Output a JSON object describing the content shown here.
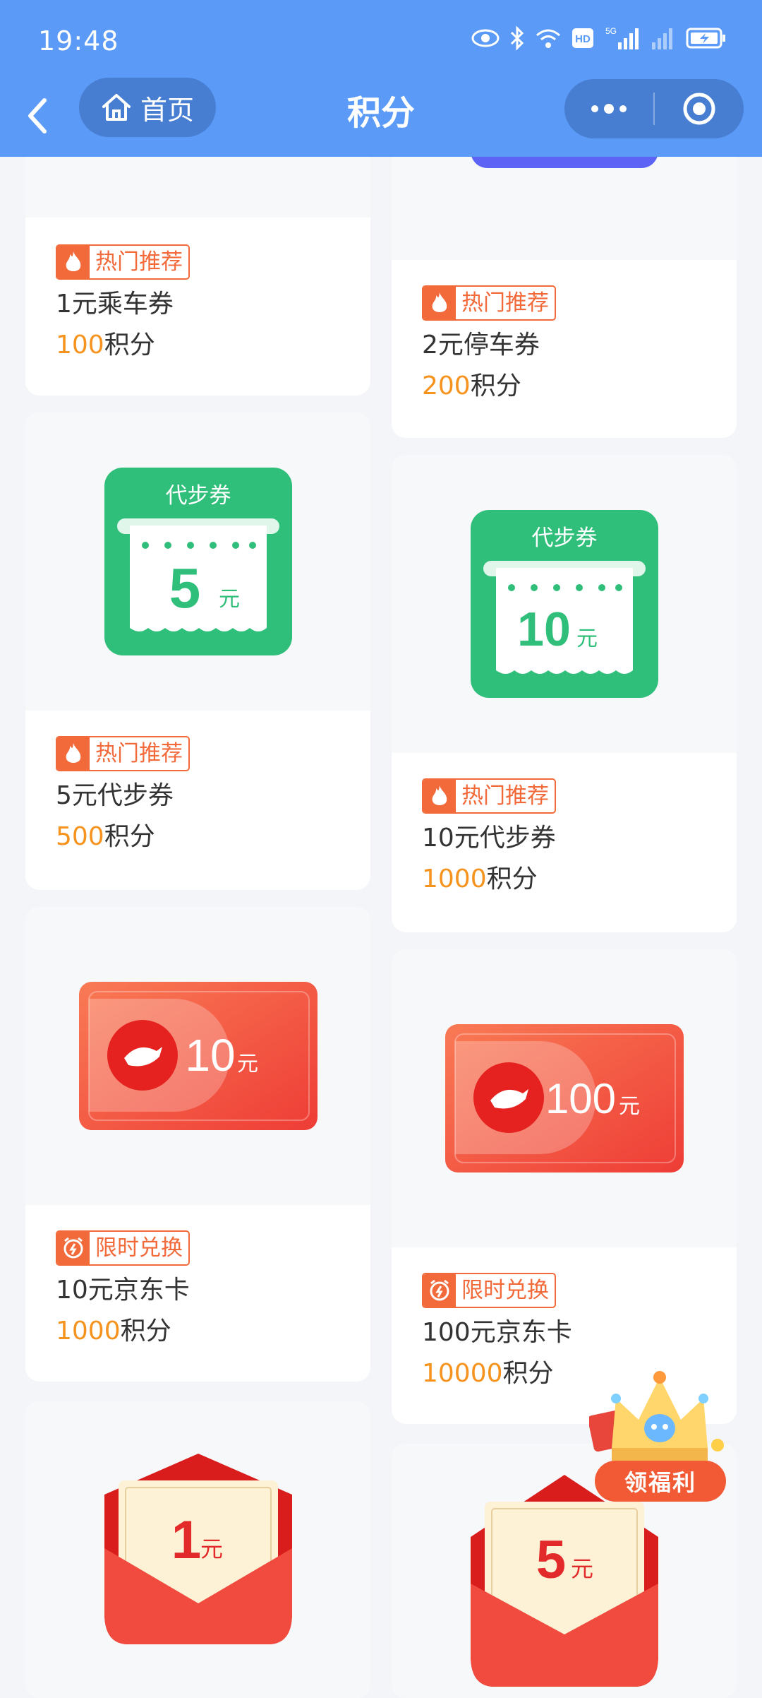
{
  "status_bar": {
    "time": "19:48",
    "net_label": "5G"
  },
  "nav": {
    "home_label": "首页",
    "title": "积分"
  },
  "tag_labels": {
    "hot": "热门推荐",
    "limited": "限时兑换"
  },
  "points_unit": "积分",
  "currency_unit": "元",
  "voucher_banner": "代步券",
  "left_column": [
    {
      "name": "1元乘车券",
      "points": "100",
      "tag": "热门推荐"
    },
    {
      "name": "5元代步券",
      "points": "500",
      "tag": "热门推荐",
      "amount": "5"
    },
    {
      "name": "10元京东卡",
      "points": "1000",
      "tag": "限时兑换",
      "amount": "10"
    },
    {
      "amount": "1"
    }
  ],
  "right_column": [
    {
      "name": "2元停车券",
      "points": "200",
      "tag": "热门推荐"
    },
    {
      "name": "10元代步券",
      "points": "1000",
      "tag": "热门推荐",
      "amount": "10"
    },
    {
      "name": "100元京东卡",
      "points": "10000",
      "tag": "限时兑换",
      "amount": "100"
    },
    {
      "amount": "5"
    }
  ],
  "floating_button": {
    "label": "领福利"
  },
  "colors": {
    "header_bg": "#5b9bf7",
    "tag_orange": "#f26a3a",
    "points_orange": "#f5931e",
    "voucher_green": "#2fbf7a",
    "jd_red": "#f04e3c",
    "envelope_red": "#ee3b3b"
  }
}
